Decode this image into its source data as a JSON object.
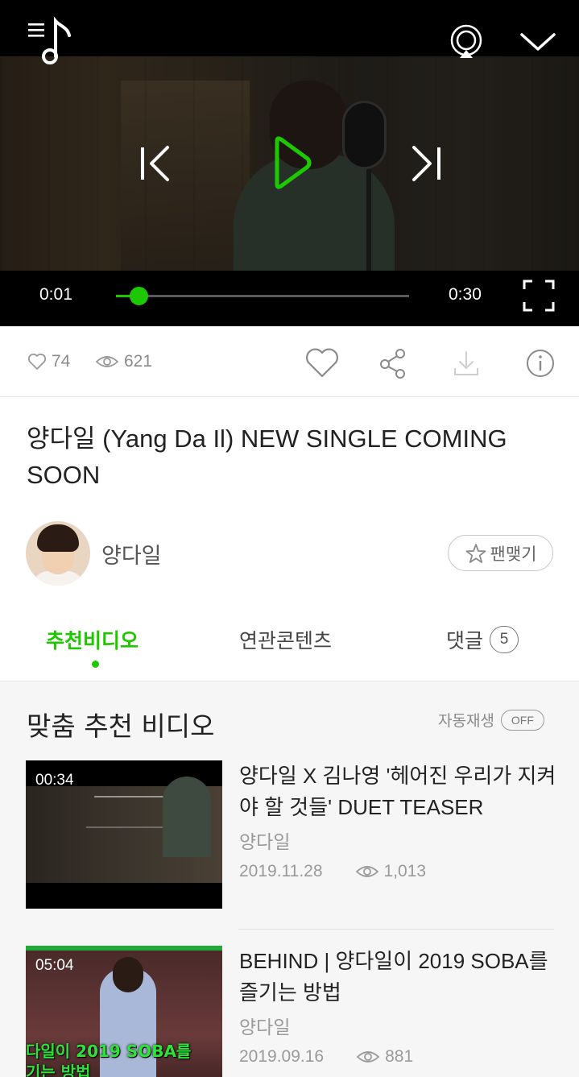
{
  "player": {
    "current_time": "0:01",
    "duration": "0:30",
    "progress_fraction": 0.08,
    "accent": "#1ec800",
    "icons": {
      "menu": "music-menu-icon",
      "cast": "airplay-icon",
      "close": "chevron-down-icon",
      "prev": "skip-previous-icon",
      "play": "play-icon",
      "next": "skip-next-icon",
      "fullscreen": "fullscreen-icon"
    }
  },
  "stats": {
    "likes": "74",
    "views": "621"
  },
  "video": {
    "title": "양다일 (Yang Da Il) NEW SINGLE COMING SOON"
  },
  "channel": {
    "name": "양다일",
    "fan_button": "팬맺기"
  },
  "tabs": [
    {
      "label": "추천비디오",
      "active": true
    },
    {
      "label": "연관콘텐츠",
      "active": false
    },
    {
      "label": "댓글",
      "count": "5",
      "active": false
    }
  ],
  "recommendations": {
    "section_title": "맞춤 추천 비디오",
    "autoplay_label": "자동재생",
    "autoplay_state": "OFF",
    "items": [
      {
        "duration": "00:34",
        "title": "양다일 X 김나영 '헤어진 우리가 지켜야 할 것들' DUET TEASER",
        "channel": "양다일",
        "date": "2019.11.28",
        "views": "1,013"
      },
      {
        "duration": "05:04",
        "title": "BEHIND | 양다일이 2019 SOBA를 즐기는 방법",
        "channel": "양다일",
        "date": "2019.09.16",
        "views": "881",
        "thumb_caption": "다일이 2019 SOBA를\n기는 방법"
      }
    ]
  }
}
